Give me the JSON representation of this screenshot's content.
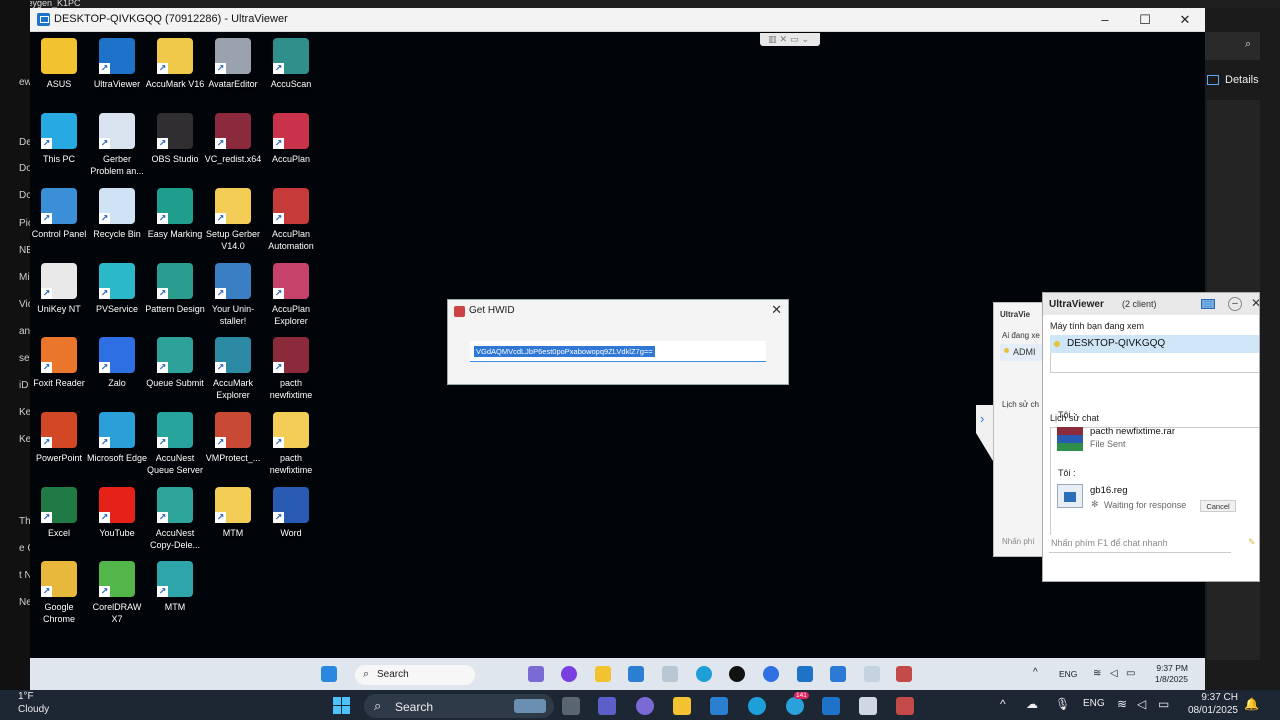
{
  "host": {
    "top_tab_text": "...eygen_K1PC",
    "sidebar_fragments": [
      "ew",
      "De",
      "Do",
      "Do",
      "Pic",
      "NE",
      "Mi",
      "Vic",
      "an",
      "se",
      "iD",
      "Ke",
      "Ke",
      "Th",
      "e C",
      "t N",
      "Ne"
    ],
    "details_label": "Details",
    "weather_temp": "1°F",
    "weather_text": "Cloudy",
    "search_label": "Search",
    "lang": "ENG",
    "clock_time": "9:37 CH",
    "clock_date": "08/01/2025",
    "telegram_badge": "141"
  },
  "window": {
    "title": "DESKTOP-QIVKGQQ (70912286) - UltraViewer",
    "minimize": "–",
    "maximize": "☐",
    "close": "✕",
    "mini_toolbar": "▥✕▭⌄"
  },
  "desktop_icons": [
    {
      "label": "ASUS",
      "color": "#f2c230"
    },
    {
      "label": "UltraViewer",
      "color": "#1e73c8"
    },
    {
      "label": "AccuMark V16",
      "color": "#f0c94a"
    },
    {
      "label": "AvatarEditor",
      "color": "#9aa3ad"
    },
    {
      "label": "AccuScan",
      "color": "#2f8f8a"
    },
    {
      "label": "This PC",
      "color": "#27a9e1"
    },
    {
      "label": "Gerber Problem an...",
      "color": "#d9e3f0"
    },
    {
      "label": "OBS Studio",
      "color": "#302e31"
    },
    {
      "label": "VC_redist.x64",
      "color": "#8b2a3d"
    },
    {
      "label": "AccuPlan",
      "color": "#c9324a"
    },
    {
      "label": "Control Panel",
      "color": "#3b8fd6"
    },
    {
      "label": "Recycle Bin",
      "color": "#cfe3f4"
    },
    {
      "label": "Easy Marking",
      "color": "#1f9e8e"
    },
    {
      "label": "Setup Gerber V14.0",
      "color": "#f3cd55"
    },
    {
      "label": "AccuPlan Automation",
      "color": "#c73a3a"
    },
    {
      "label": "UniKey NT",
      "color": "#e9e9ea"
    },
    {
      "label": "PVService",
      "color": "#2bb9c9"
    },
    {
      "label": "Pattern Design",
      "color": "#2b9d8f"
    },
    {
      "label": "Your Unin-staller!",
      "color": "#3a7fc4"
    },
    {
      "label": "AccuPlan Explorer",
      "color": "#c6426b"
    },
    {
      "label": "Foxit Reader",
      "color": "#e9762b"
    },
    {
      "label": "Zalo",
      "color": "#2f6fe4"
    },
    {
      "label": "Queue Submit",
      "color": "#2da29b"
    },
    {
      "label": "AccuMark Explorer",
      "color": "#2d8aa5"
    },
    {
      "label": "pacth newfixtime",
      "color": "#8a2a3a"
    },
    {
      "label": "PowerPoint",
      "color": "#d24726"
    },
    {
      "label": "Microsoft Edge",
      "color": "#2a9fd8"
    },
    {
      "label": "AccuNest Queue Server",
      "color": "#27a59d"
    },
    {
      "label": "VMProtect_...",
      "color": "#c94a34"
    },
    {
      "label": "pacth newfixtime",
      "color": "#f3cd55"
    },
    {
      "label": "Excel",
      "color": "#1f7a45"
    },
    {
      "label": "YouTube",
      "color": "#e62117"
    },
    {
      "label": "AccuNest Copy-Dele...",
      "color": "#2ea59b"
    },
    {
      "label": "MTM",
      "color": "#f3cd55"
    },
    {
      "label": "Word",
      "color": "#2a5bb3"
    },
    {
      "label": "Google Chrome",
      "color": "#e8b83c"
    },
    {
      "label": "CorelDRAW X7",
      "color": "#52b64a"
    },
    {
      "label": "MTM",
      "color": "#2ea5a9"
    }
  ],
  "hwid_dialog": {
    "title": "Get HWID",
    "close": "✕",
    "value": "VGdAQMVcdLJbP6est0poPxabowopq9ZLVdklZ7g=="
  },
  "uv_side": {
    "title": "UltraVie",
    "watching": "Ai đang xe",
    "admin": "ADMI",
    "history": "Lịch sử ch",
    "input": "Nhấn phí"
  },
  "chat": {
    "title": "UltraViewer",
    "clients": "(2 client)",
    "viewing_label": "Máy tính bạn đang xem",
    "computer_name": "DESKTOP-QIVKGQQ",
    "history_label": "Lịch sử chat",
    "messages": [
      {
        "sender": "Tôi :",
        "file": "pacth newfixtime.rar",
        "status": "File Sent"
      },
      {
        "sender": "Tôi :",
        "file": "gb16.reg",
        "status": "Waiting for response"
      }
    ],
    "cancel_label": "Cancel",
    "input_placeholder": "Nhấn phím F1 để chat nhanh"
  },
  "remote_taskbar": {
    "search_label": "Search",
    "lang": "ENG",
    "time": "9:37 PM",
    "date": "1/8/2025"
  }
}
